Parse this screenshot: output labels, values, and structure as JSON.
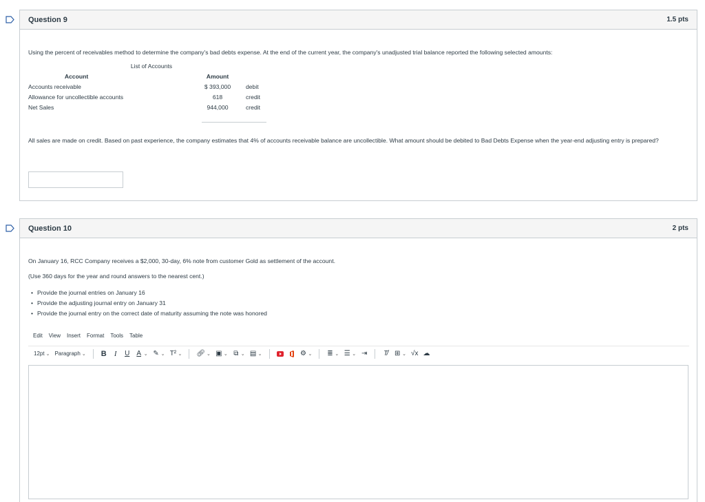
{
  "q9": {
    "title": "Question 9",
    "points": "1.5 pts",
    "prompt": "Using the percent of receivables method to determine the company's bad debts expense. At the end of the current year, the company's unadjusted trial balance reported the following selected amounts:",
    "table": {
      "caption": "List of Accounts",
      "headers": [
        "Account",
        "Amount"
      ],
      "rows": [
        {
          "account": "Accounts receivable",
          "amount": "$ 393,000",
          "type": "debit"
        },
        {
          "account": "Allowance for uncollectible accounts",
          "amount": "618",
          "type": "credit"
        },
        {
          "account": "Net Sales",
          "amount": "944,000",
          "type": "credit"
        }
      ]
    },
    "question": "All sales are made on credit. Based on past experience, the company estimates that 4% of accounts receivable balance are uncollectible. What amount should be debited to Bad Debts Expense when the year-end adjusting entry is prepared?",
    "answer_value": ""
  },
  "q10": {
    "title": "Question 10",
    "points": "2 pts",
    "prompt": "On January 16, RCC Company receives a $2,000, 30-day, 6% note from customer Gold as settlement of the account.",
    "note": "(Use 360 days for the year and round answers to the nearest cent.)",
    "bullets": [
      "Provide the journal entries on January 16",
      "Provide the adjusting journal entry on January 31",
      "Provide the journal entry on the correct date of maturity assuming the note was honored"
    ],
    "editor": {
      "menu": [
        "Edit",
        "View",
        "Insert",
        "Format",
        "Tools",
        "Table"
      ],
      "font_size": "12pt",
      "block_format": "Paragraph",
      "content": ""
    }
  },
  "colors": {
    "border": "#c7cdd1",
    "header_bg": "#f5f5f5",
    "text": "#2d3b45",
    "flag": "#2d5fa6",
    "media_red": "#e0242f",
    "office_orange": "#e3410f"
  }
}
